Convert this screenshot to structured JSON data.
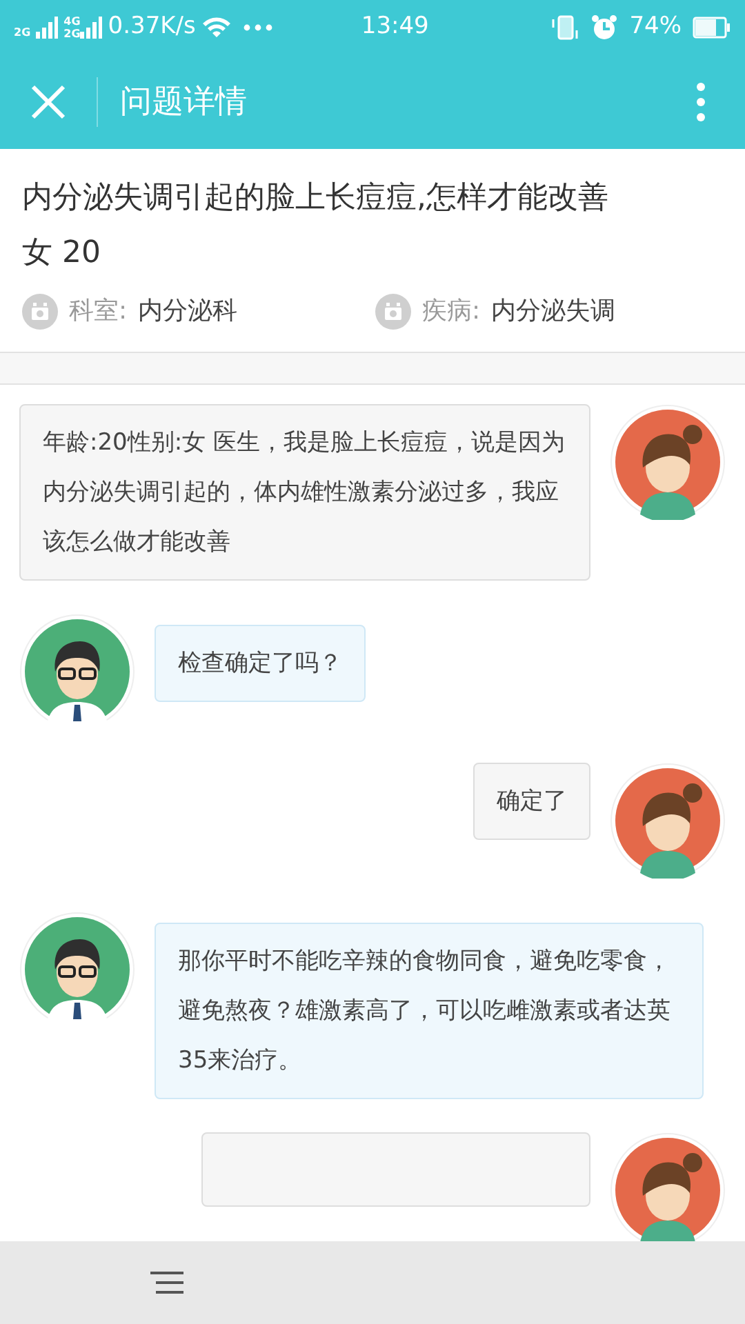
{
  "status_bar": {
    "network_labels": [
      "2G",
      "4G",
      "2G"
    ],
    "speed": "0.37K/s",
    "time": "13:49",
    "battery": "74%"
  },
  "header": {
    "title": "问题详情"
  },
  "question": {
    "title": "内分泌失调引起的脸上长痘痘,怎样才能改善",
    "patient": "女 20"
  },
  "meta": [
    {
      "label": "科室:",
      "value": "内分泌科"
    },
    {
      "label": "疾病:",
      "value": "内分泌失调"
    }
  ],
  "messages": [
    {
      "kind": "patient",
      "text": "年龄:20性别:女 医生，我是脸上长痘痘，说是因为内分泌失调引起的，体内雄性激素分泌过多，我应该怎么做才能改善"
    },
    {
      "kind": "doctor",
      "text": "检查确定了吗？"
    },
    {
      "kind": "patient",
      "text": "确定了"
    },
    {
      "kind": "doctor",
      "text": "那你平时不能吃辛辣的食物同食，避免吃零食，避免熬夜？雄激素高了，可以吃雌激素或者达英35来治疗。"
    },
    {
      "kind": "patient"
    }
  ]
}
